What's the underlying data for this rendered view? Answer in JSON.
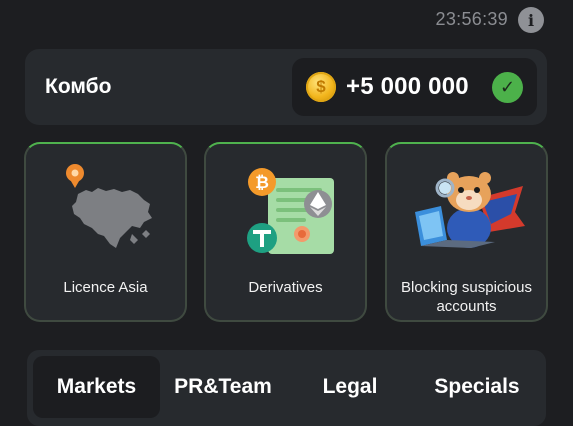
{
  "header": {
    "timer": "23:56:39",
    "info_icon": "info-icon"
  },
  "combo": {
    "label": "Комбо",
    "reward": "+5 000 000",
    "coin_icon": "coin-icon",
    "coin_symbol": "$",
    "check_icon": "check-icon"
  },
  "cards": [
    {
      "label": "Licence Asia",
      "icon": "asia-map-icon"
    },
    {
      "label": "Derivatives",
      "icon": "derivatives-document-icon"
    },
    {
      "label": "Blocking suspicious accounts",
      "icon": "hamster-laptop-icon"
    }
  ],
  "tabs": [
    {
      "label": "Markets",
      "active": true
    },
    {
      "label": "PR&Team",
      "active": false
    },
    {
      "label": "Legal",
      "active": false
    },
    {
      "label": "Specials",
      "active": false
    }
  ],
  "colors": {
    "background": "#1d1e21",
    "panel": "#272a2e",
    "accent_green": "#4fb24e",
    "coin_gold": "#f2b51c"
  }
}
